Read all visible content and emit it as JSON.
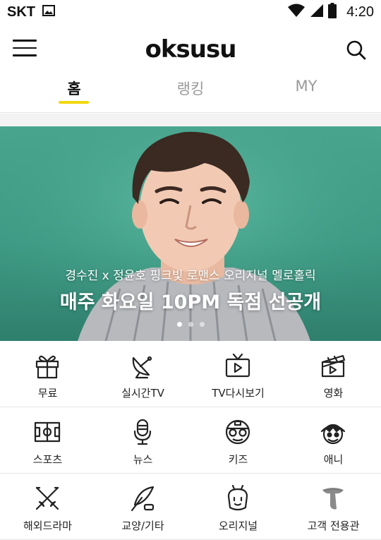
{
  "status_bar": {
    "carrier": "SKT",
    "time": "4:20",
    "icons": [
      "image-icon",
      "wifi-icon",
      "signal-icon",
      "battery-icon"
    ]
  },
  "app_bar": {
    "logo": "oksusu",
    "menu_icon": "hamburger-menu-icon",
    "search_icon": "search-icon"
  },
  "tabs": [
    {
      "label": "홈",
      "active": true
    },
    {
      "label": "랭킹",
      "active": false
    },
    {
      "label": "MY",
      "active": false
    }
  ],
  "banner": {
    "subtitle": "경수진 x 정윤호 핑크빛 로맨스 오리지널 멜로홀릭",
    "title": "매주 화요일 10PM  독점 선공개",
    "page_indicator": {
      "count": 3,
      "active_index": 0
    }
  },
  "categories": [
    {
      "label": "무료",
      "icon": "gift-icon"
    },
    {
      "label": "실시간TV",
      "icon": "satellite-dish-icon"
    },
    {
      "label": "TV다시보기",
      "icon": "tv-play-icon"
    },
    {
      "label": "영화",
      "icon": "clapperboard-icon"
    },
    {
      "label": "스포츠",
      "icon": "soccer-field-icon"
    },
    {
      "label": "뉴스",
      "icon": "microphone-icon"
    },
    {
      "label": "키즈",
      "icon": "robot-face-icon"
    },
    {
      "label": "애니",
      "icon": "anime-face-icon"
    },
    {
      "label": "해외드라마",
      "icon": "crossed-swords-icon"
    },
    {
      "label": "교양/기타",
      "icon": "quill-icon"
    },
    {
      "label": "오리지널",
      "icon": "original-character-icon"
    },
    {
      "label": "고객 전용관",
      "icon": "t-logo-icon"
    }
  ],
  "colors": {
    "accent": "#f2d80f",
    "banner_bg": "#3e9a84",
    "text": "#111111",
    "inactive_tab": "#9a9a9a"
  }
}
